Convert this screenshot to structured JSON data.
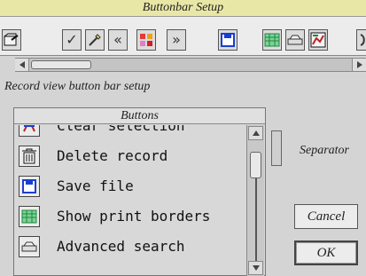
{
  "window": {
    "title": "Buttonbar Setup"
  },
  "toolbar": {
    "buttons": [
      {
        "name": "open-file-icon"
      },
      {
        "name": "check-mark-icon",
        "glyph": "✓"
      },
      {
        "name": "wand-icon"
      },
      {
        "name": "rewind-icon",
        "glyph": "«"
      },
      {
        "name": "multi-color-icon"
      },
      {
        "name": "fast-forward-icon",
        "glyph": "»"
      },
      {
        "name": "save-disk-icon"
      },
      {
        "name": "print-borders-icon"
      },
      {
        "name": "advanced-search-icon"
      },
      {
        "name": "image-graph-icon"
      }
    ]
  },
  "subtitle": "Record view button bar setup",
  "buttons_panel": {
    "title": "Buttons",
    "items": [
      {
        "label": "Clear selection",
        "icon": "clear-selection-icon"
      },
      {
        "label": "Delete record",
        "icon": "trash-icon"
      },
      {
        "label": "Save file",
        "icon": "save-disk-icon"
      },
      {
        "label": "Show print borders",
        "icon": "print-borders-icon"
      },
      {
        "label": "Advanced search",
        "icon": "advanced-search-icon"
      }
    ]
  },
  "separator_label": "Separator",
  "cancel_label": "Cancel",
  "ok_label": "OK",
  "colors": {
    "title_bar": "#e9e7a6",
    "save_blue": "#1a3fd0",
    "grid_green": "#1a8a3a"
  }
}
